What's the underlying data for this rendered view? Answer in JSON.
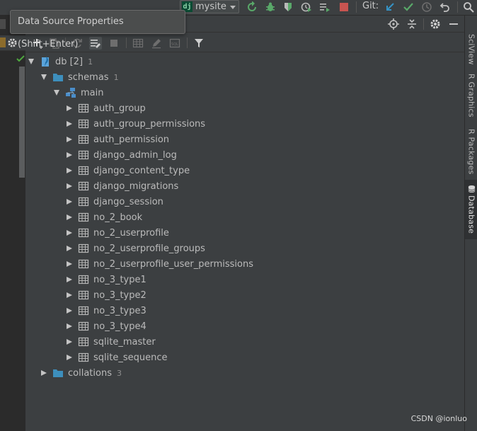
{
  "topbar": {
    "run_config": "mysite",
    "run_config_icon": "dj",
    "git_label": "Git:"
  },
  "tooltip": {
    "text": "Data Source Properties (Shift+Enter)"
  },
  "tree": {
    "root": {
      "label": "db [2]",
      "count": "1"
    },
    "schemas": {
      "label": "schemas",
      "count": "1"
    },
    "main": {
      "label": "main"
    },
    "tables": [
      "auth_group",
      "auth_group_permissions",
      "auth_permission",
      "django_admin_log",
      "django_content_type",
      "django_migrations",
      "django_session",
      "no_2_book",
      "no_2_userprofile",
      "no_2_userprofile_groups",
      "no_2_userprofile_user_permissions",
      "no_3_type1",
      "no_3_type2",
      "no_3_type3",
      "no_3_type4",
      "sqlite_master",
      "sqlite_sequence"
    ],
    "collations": {
      "label": "collations",
      "count": "3"
    }
  },
  "rightbar": {
    "tabs": [
      "SciView",
      "R Graphics",
      "R Packages",
      "Database"
    ],
    "active": "Database"
  },
  "watermark": "CSDN @ionluo",
  "colors": {
    "background": "#3c3f41",
    "folder": "#3d8fbd",
    "check": "#4fa83f",
    "run_green": "#59a869",
    "stop_red": "#c75450",
    "git_blue": "#3592c4"
  }
}
